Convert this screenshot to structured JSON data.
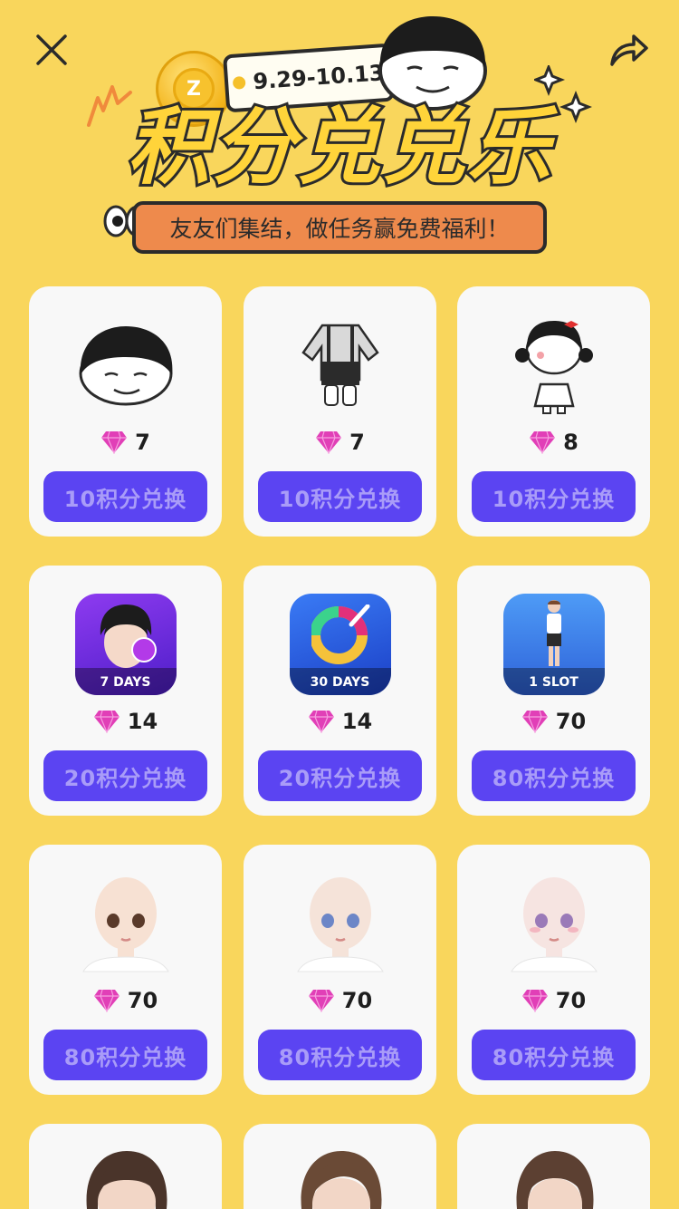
{
  "header": {
    "date_range": "9.29-10.13",
    "title": "积分兑兑乐",
    "subtitle": "友友们集结，做任务赢免费福利！",
    "coin_letter": "Z"
  },
  "icons": {
    "close": "close-icon",
    "share": "share-icon",
    "gem": "gem-icon"
  },
  "colors": {
    "background": "#F9D65C",
    "button": "#5B44F2",
    "button_text": "#A99CF8",
    "card": "#F8F8F8",
    "gem": "#E13FB7"
  },
  "items": [
    {
      "name": "meme-face-head",
      "gems": "7",
      "button": "10积分兑换"
    },
    {
      "name": "suspender-outfit",
      "gems": "7",
      "button": "10积分兑换"
    },
    {
      "name": "girl-meme-character",
      "gems": "8",
      "button": "10积分兑换"
    },
    {
      "name": "face-edit-7-days",
      "label": "7 DAYS",
      "gems": "14",
      "button": "20积分兑换"
    },
    {
      "name": "color-pass-30-days",
      "label": "30 DAYS",
      "gems": "14",
      "button": "20积分兑换"
    },
    {
      "name": "avatar-1-slot",
      "label": "1 SLOT",
      "gems": "70",
      "button": "80积分兑换"
    },
    {
      "name": "face-brown-eyes",
      "gems": "70",
      "button": "80积分兑换"
    },
    {
      "name": "face-blue-eyes",
      "gems": "70",
      "button": "80积分兑换"
    },
    {
      "name": "face-pink-eyes",
      "gems": "70",
      "button": "80积分兑换"
    }
  ]
}
